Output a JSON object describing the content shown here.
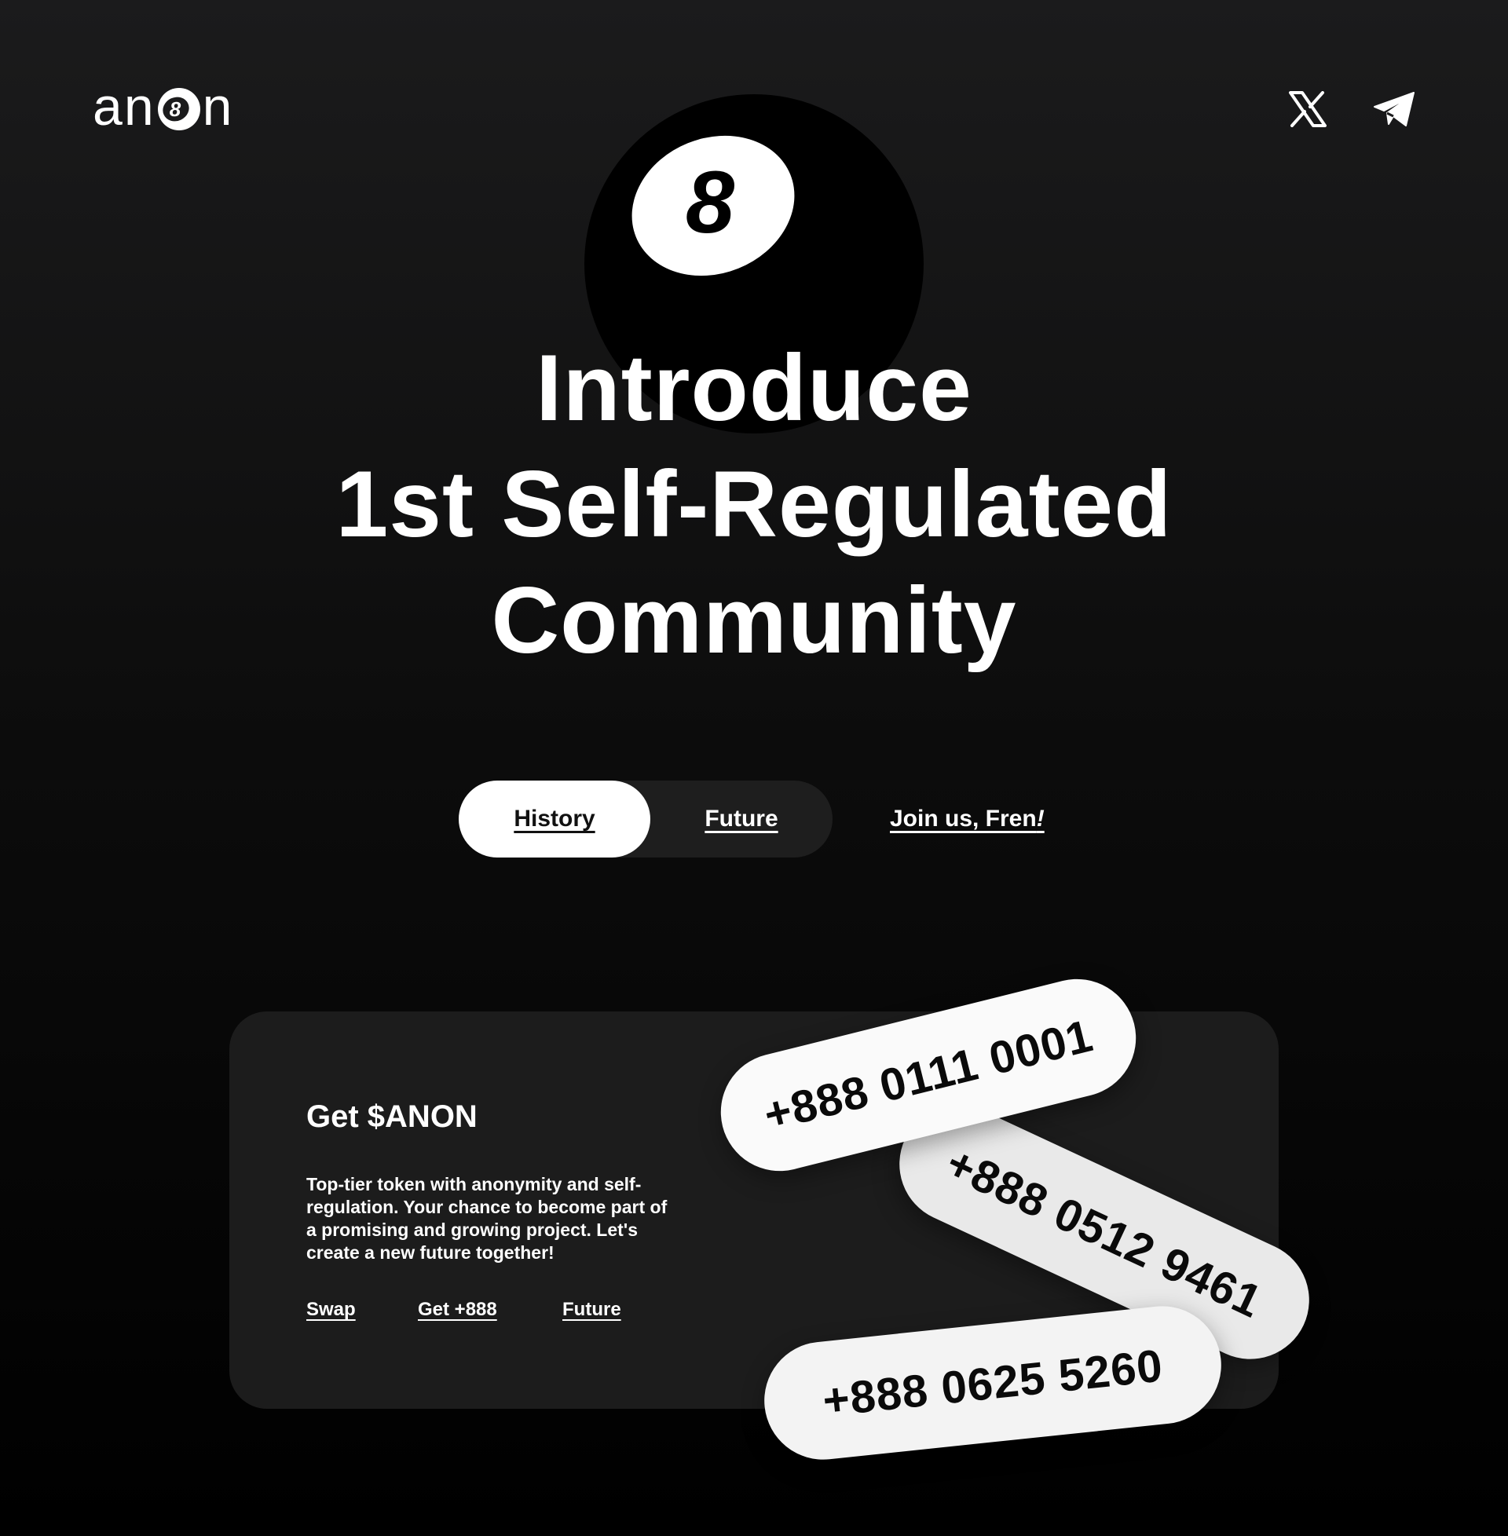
{
  "header": {
    "logo": {
      "prefix": "an",
      "suffix": "n",
      "ball_number": "8"
    },
    "social": [
      {
        "name": "x-icon"
      },
      {
        "name": "telegram-icon"
      }
    ]
  },
  "hero": {
    "ball_number": "8",
    "headline": [
      "Introduce",
      "1st Self-Regulated",
      "Community"
    ]
  },
  "tabs": {
    "items": [
      {
        "label": "History",
        "active": true
      },
      {
        "label": "Future",
        "active": false
      }
    ],
    "join_label": "Join us, Fren",
    "join_suffix": "!"
  },
  "card": {
    "title": "Get $ANON",
    "description": "Top-tier token with anonymity and self-regulation. Your chance to become part of a promising and growing project. Let's create a new future together!",
    "links": [
      "Swap",
      "Get +888",
      "Future"
    ]
  },
  "phone_numbers": [
    "+888 0111 0001",
    "+888 0512 9461",
    "+888 0625 5260"
  ],
  "colors": {
    "background_top": "#1b1b1c",
    "background_bottom": "#000000",
    "text": "#ffffff",
    "card": "#1c1c1c",
    "tab_active_bg": "#ffffff",
    "tab_track_bg": "#1e1e1e",
    "pill_bg": "#fafafa"
  }
}
